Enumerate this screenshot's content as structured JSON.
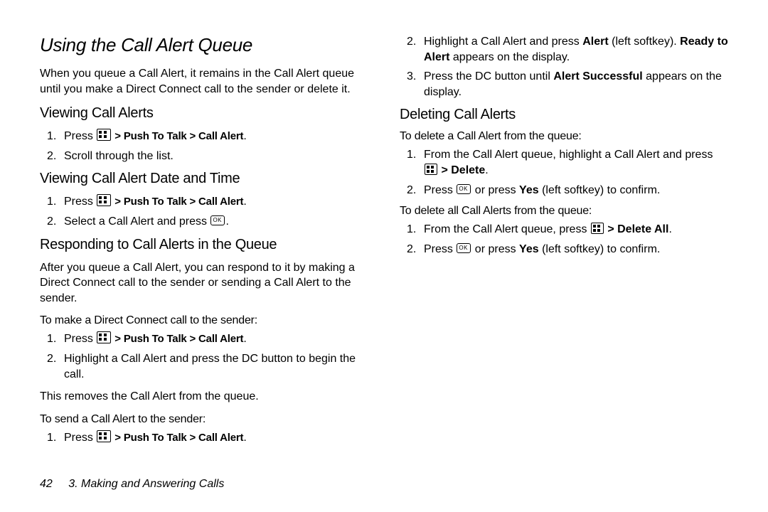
{
  "title": "Using the Call Alert Queue",
  "intro": "When you queue a Call Alert, it remains in the Call Alert queue until you make a Direct Connect call to the sender or delete it.",
  "sub1": "Viewing Call Alerts",
  "s1_step1_prefix": "Press ",
  "s1_step1_bold": " > Push To Talk > Call Alert",
  "s1_step1_suffix": ".",
  "s1_step2": "Scroll through the list.",
  "sub2": "Viewing Call Alert Date and Time",
  "s2_step1_prefix": "Press ",
  "s2_step1_bold": " > Push To Talk > Call Alert",
  "s2_step1_suffix": ".",
  "s2_step2_a": "Select a Call Alert and press ",
  "s2_step2_b": ".",
  "sub3": "Responding to Call Alerts in the Queue",
  "s3_para": "After you queue a Call Alert, you can respond to it by making a Direct Connect call to the sender or sending a Call Alert to the sender.",
  "s3_lead1": "To make a Direct Connect call to the sender:",
  "s3a_step1_prefix": "Press ",
  "s3a_step1_bold": " > Push To Talk > Call Alert",
  "s3a_step1_suffix": ".",
  "s3a_step2": "Highlight a Call Alert and press the DC button to begin the call.",
  "s3a_result": "This removes the Call Alert from the queue.",
  "s3_lead2": "To send a Call Alert to the sender:",
  "s3b_step1_prefix": "Press ",
  "s3b_step1_bold": " > Push To Talk > Call Alert",
  "s3b_step1_suffix": ".",
  "s3b_step2_a": "Highlight a Call Alert and press ",
  "s3b_step2_bold1": "Alert",
  "s3b_step2_b": " (left softkey). ",
  "s3b_step2_bold2": "Ready to Alert",
  "s3b_step2_c": " appears on the display.",
  "s3b_step3_a": "Press the DC button until ",
  "s3b_step3_bold": "Alert Successful",
  "s3b_step3_b": " appears on the display.",
  "sub4": "Deleting Call Alerts",
  "s4_lead1": "To delete a Call Alert from the queue:",
  "s4a_step1_a": "From the Call Alert queue, highlight a Call Alert and press ",
  "s4a_step1_bold": " > Delete",
  "s4a_step1_c": ".",
  "s4a_step2_a": "Press ",
  "s4a_step2_b": " or press ",
  "s4a_step2_bold": "Yes",
  "s4a_step2_c": " (left softkey) to confirm.",
  "s4_lead2": "To delete all Call Alerts from the queue:",
  "s4b_step1_a": "From the Call Alert queue, press ",
  "s4b_step1_bold": " > Delete All",
  "s4b_step1_c": ".",
  "s4b_step2_a": "Press ",
  "s4b_step2_b": " or press ",
  "s4b_step2_bold": "Yes",
  "s4b_step2_c": " (left softkey) to confirm.",
  "footer_page": "42",
  "footer_text": "3. Making and Answering Calls"
}
